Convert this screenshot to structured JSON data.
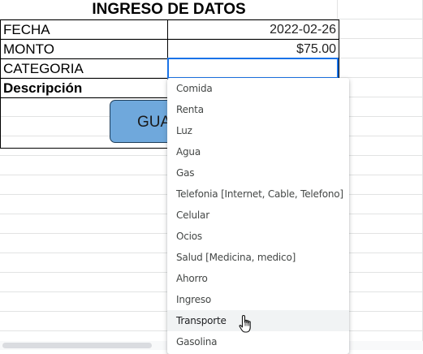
{
  "sheet": {
    "title": "INGRESO DE DATOS",
    "rows": [
      {
        "label": "FECHA",
        "value": "2022-02-26"
      },
      {
        "label": "MONTO",
        "value": "$75.00"
      },
      {
        "label": "CATEGORIA",
        "value": ""
      },
      {
        "label": "Descripción",
        "value": ""
      }
    ],
    "save_button_label": "GUA"
  },
  "dropdown": {
    "items": [
      "Comida",
      "Renta",
      "Luz",
      "Agua",
      "Gas",
      "Telefonia [Internet, Cable, Telefono]",
      "Celular",
      "Ocios",
      "Salud [Medicina, medico]",
      "Ahorro",
      "Ingreso",
      "Transporte",
      "Gasolina"
    ],
    "hovered": "Transporte"
  },
  "colors": {
    "selection_border": "#1a73e8",
    "button_fill": "#6fa8dc",
    "grid_line": "#e2e3e3"
  }
}
